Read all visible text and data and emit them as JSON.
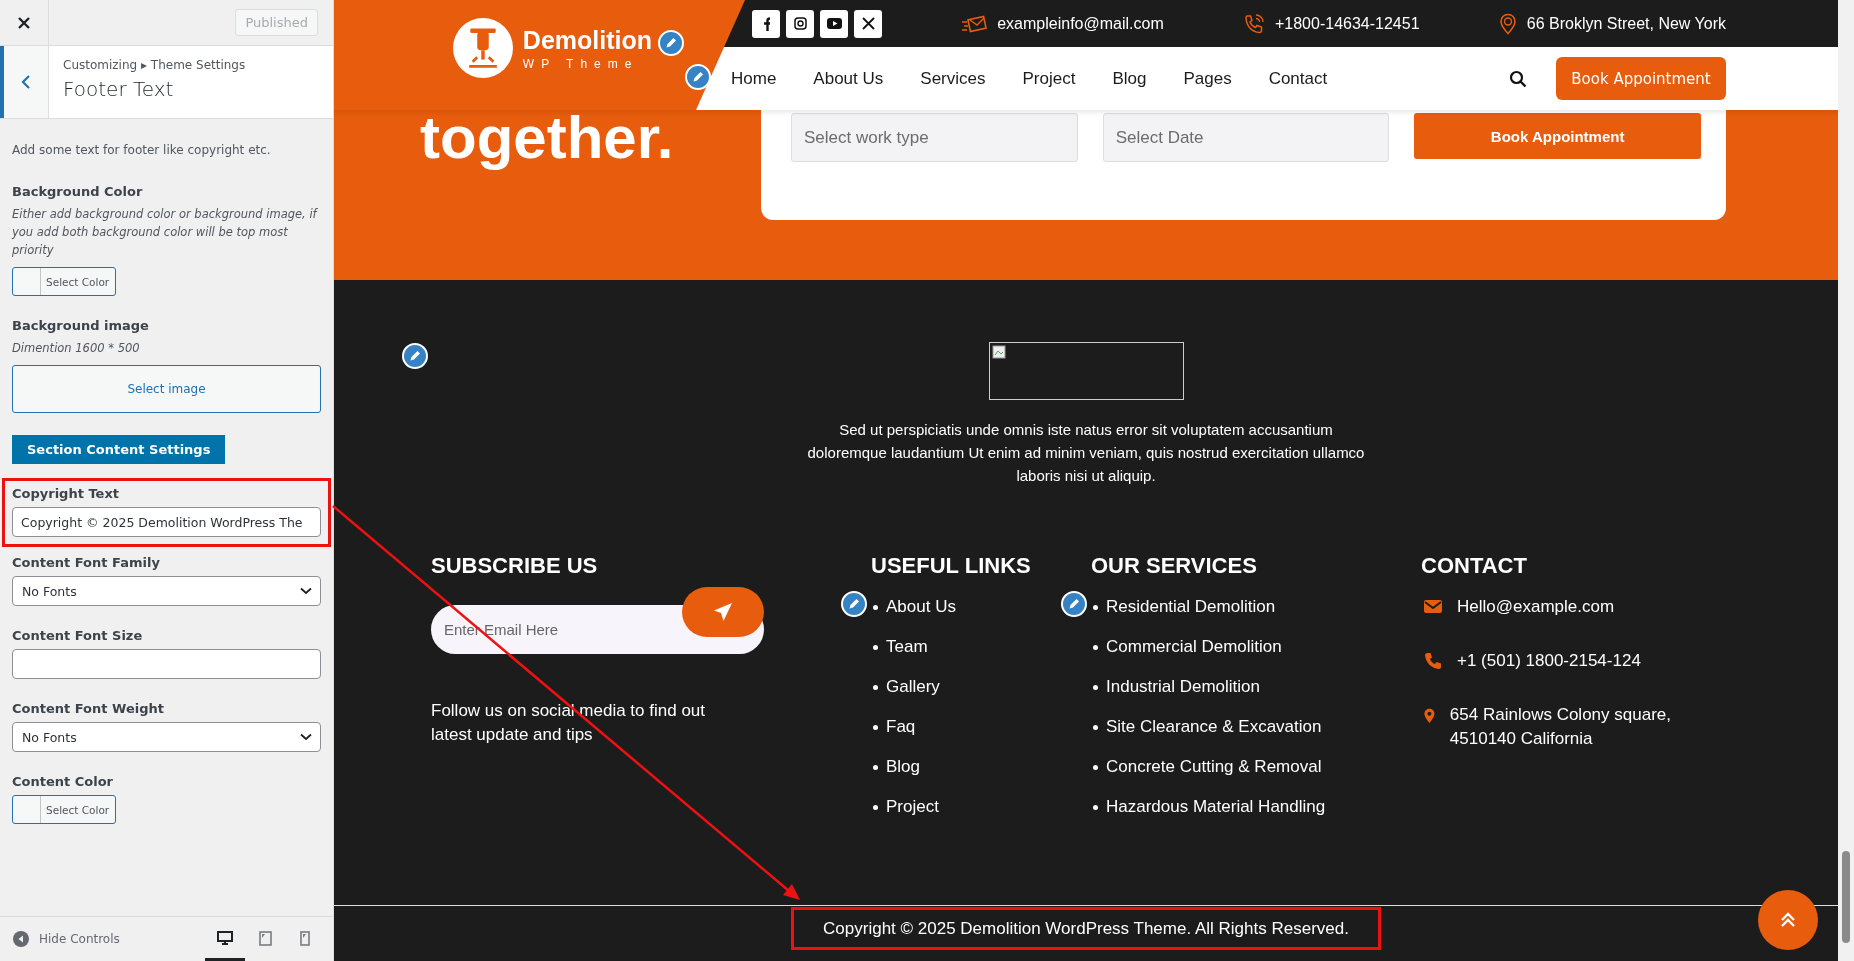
{
  "customizer": {
    "publish_button": "Published",
    "breadcrumb": "Customizing ▸ Theme Settings",
    "title": "Footer Text",
    "controls": [
      {
        "kind": "note",
        "text": "Add some text for footer like copyright etc."
      },
      {
        "kind": "color",
        "label": "Background Color",
        "description": "Either add background color or background image, if you add both background color will be top most priority",
        "button": "Select Color"
      },
      {
        "kind": "image",
        "label": "Background image",
        "description": "Dimention 1600 * 500",
        "button": "Select image"
      },
      {
        "kind": "section_button",
        "label": "Section Content Settings"
      },
      {
        "kind": "text",
        "label": "Copyright Text",
        "value": "Copyright © 2025 Demolition WordPress The",
        "highlighted": true
      },
      {
        "kind": "select",
        "label": "Content Font Family",
        "value": "No Fonts"
      },
      {
        "kind": "text",
        "label": "Content Font Size"
      },
      {
        "kind": "select",
        "label": "Content Font Weight",
        "value": "No Fonts"
      },
      {
        "kind": "color",
        "label": "Content Color",
        "button": "Select Color"
      }
    ],
    "footer": {
      "hide_controls": "Hide Controls",
      "devices": [
        {
          "kind": "desktop",
          "selected": true
        },
        {
          "kind": "tablet",
          "selected": false
        },
        {
          "kind": "mobile",
          "selected": false
        }
      ]
    }
  },
  "preview": {
    "top_bar": {
      "socials": [
        {
          "kind": "facebook"
        },
        {
          "kind": "instagram"
        },
        {
          "kind": "youtube"
        },
        {
          "kind": "x"
        }
      ],
      "contacts": [
        {
          "kind": "email",
          "text": "exampleinfo@mail.com"
        },
        {
          "kind": "phone",
          "text": "+1800-14634-12451"
        },
        {
          "kind": "address",
          "text": "66 Broklyn Street, New York"
        }
      ]
    },
    "logo": {
      "name": "Demolition",
      "tagline": "WP Theme"
    },
    "nav": [
      "Home",
      "About Us",
      "Services",
      "Project",
      "Blog",
      "Pages",
      "Contact"
    ],
    "header_button": "Book Appointment",
    "hero": {
      "title": "together.",
      "fields": [
        {
          "kind": "input",
          "placeholder": "Select work type"
        },
        {
          "kind": "input",
          "placeholder": "Select Date"
        },
        {
          "kind": "button",
          "label": "Book Appointment"
        }
      ]
    },
    "footer": {
      "about": "Sed ut perspiciatis unde omnis iste natus error sit voluptatem accusantium doloremque laudantium Ut enim ad minim veniam, quis nostrud exercitation ullamco laboris nisi ut aliquip.",
      "subscribe": {
        "title": "SUBSCRIBE US",
        "placeholder": "Enter Email Here",
        "text": "Follow us on social media to find out latest update and tips"
      },
      "link_columns": [
        {
          "title": "USEFUL LINKS",
          "items": [
            "About Us",
            "Team",
            "Gallery",
            "Faq",
            "Blog",
            "Project"
          ]
        },
        {
          "title": "OUR SERVICES",
          "items": [
            "Residential Demolition",
            "Commercial Demolition",
            "Industrial Demolition",
            "Site Clearance & Excavation",
            "Concrete Cutting & Removal",
            "Hazardous Material Handling"
          ]
        }
      ],
      "contact": {
        "title": "CONTACT",
        "items": [
          {
            "kind": "email",
            "text": "Hello@example.com"
          },
          {
            "kind": "phone",
            "text": "+1 (501) 1800-2154-124"
          },
          {
            "kind": "address",
            "text": "654 Rainlows Colony square, 4510140 California"
          }
        ]
      },
      "copyright": {
        "text": "Copyright © 2025 Demolition WordPress Theme. All Rights Reserved.",
        "highlighted": true
      }
    }
  }
}
